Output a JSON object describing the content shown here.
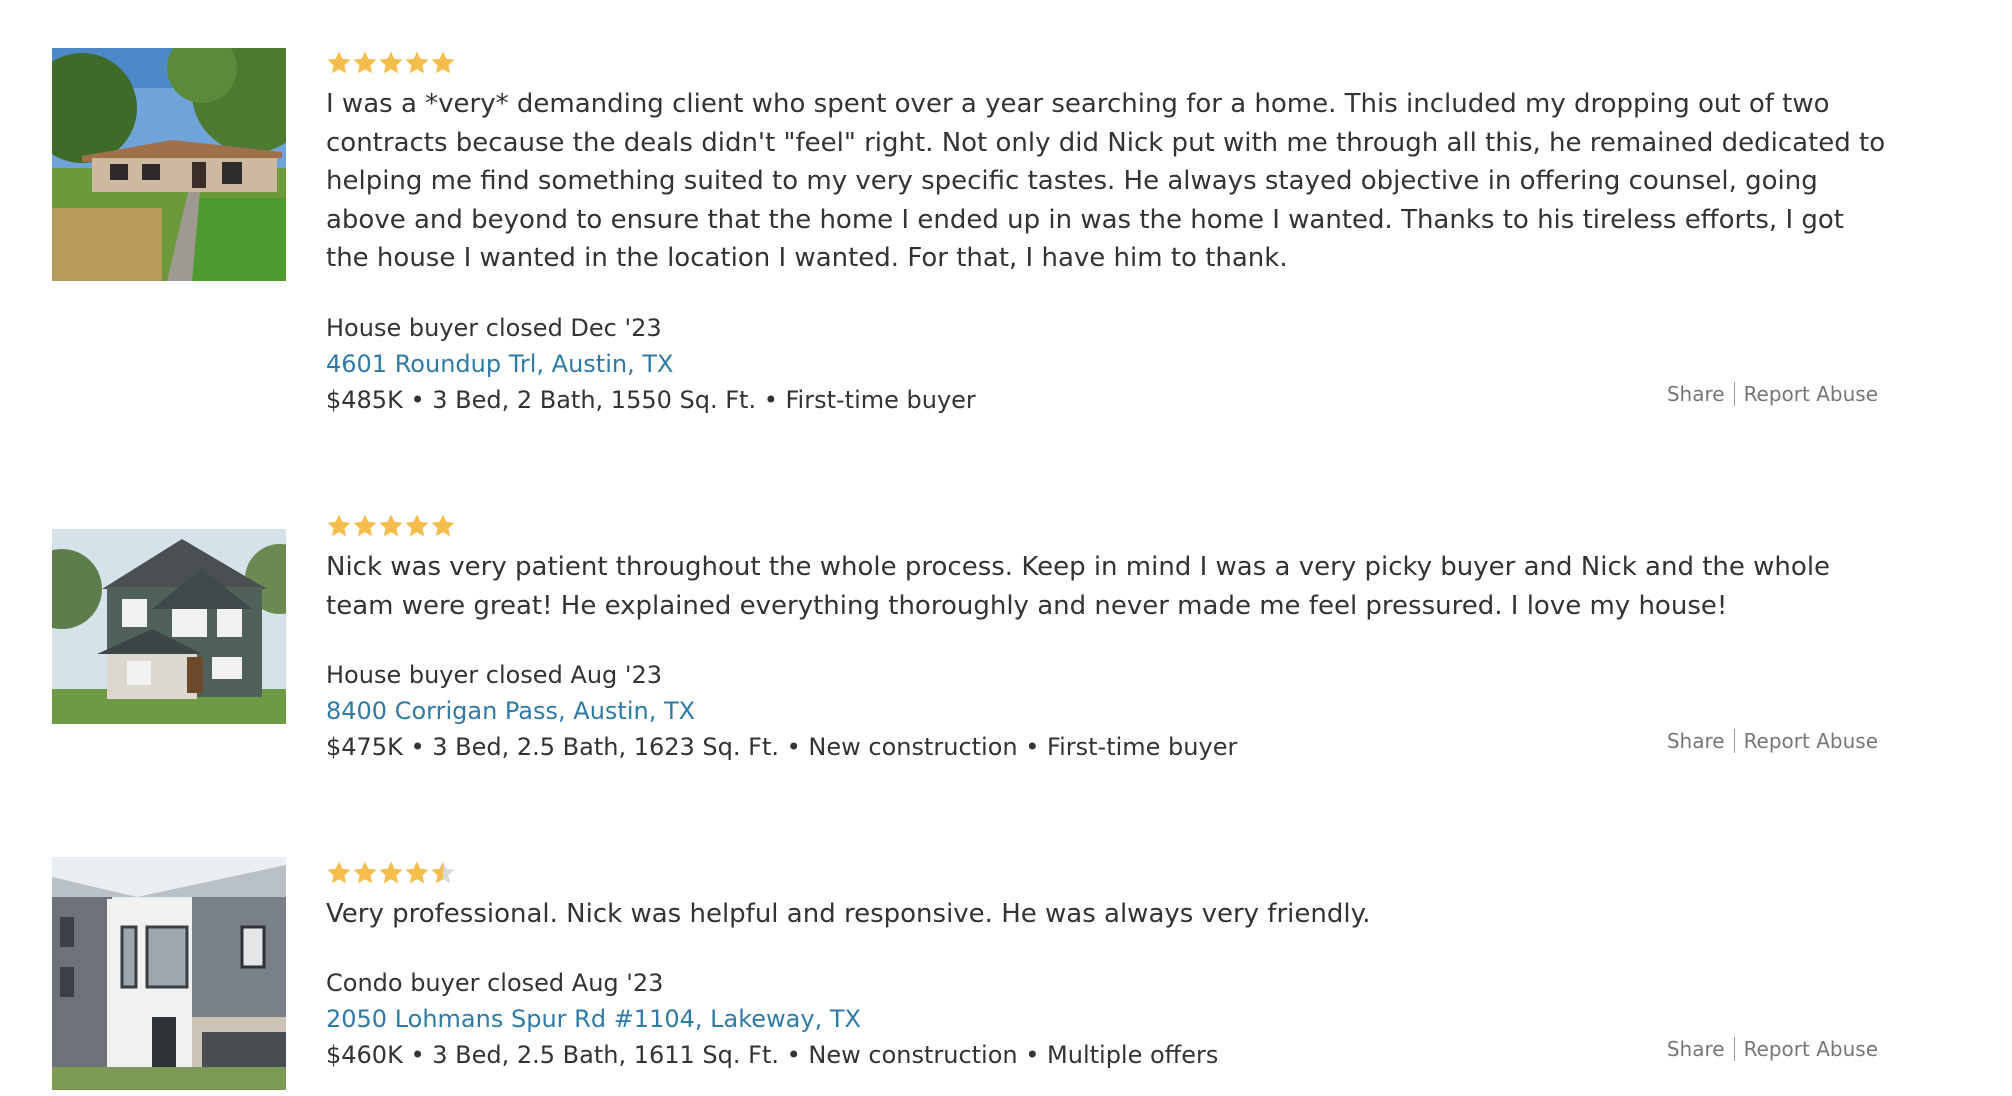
{
  "colors": {
    "star_fill": "#f5bd4b",
    "star_empty": "#d9d9d9",
    "link": "#2f7ba6",
    "text": "#333333",
    "muted": "#767676"
  },
  "reviews": [
    {
      "rating": 5,
      "photo_icon": "house-photo-single-story",
      "text": "I was a *very* demanding client who spent over a year searching for a home. This included my dropping out of two contracts because the deals didn't \"feel\" right. Not only did Nick put with me through all this, he remained dedicated to helping me find something suited to my very specific tastes. He always stayed objective in offering counsel, going above and beyond to ensure that the home I ended up in was the home I wanted. Thanks to his tireless efforts, I got the house I wanted in the location I wanted. For that, I have him to thank.",
      "closed": "House buyer closed Dec '23",
      "address": "4601 Roundup Trl, Austin, TX",
      "details": "$485K • 3 Bed, 2 Bath, 1550 Sq. Ft. • First-time buyer",
      "share_label": "Share",
      "report_label": "Report Abuse"
    },
    {
      "rating": 5,
      "photo_icon": "house-photo-two-story",
      "text": "Nick was very patient throughout the whole process. Keep in mind I was a very picky buyer and Nick and the whole team were great! He explained everything thoroughly and never made me feel pressured. I love my house!",
      "closed": "House buyer closed Aug '23",
      "address": "8400 Corrigan Pass, Austin, TX",
      "details": "$475K • 3 Bed, 2.5 Bath, 1623 Sq. Ft. • New construction • First-time buyer",
      "share_label": "Share",
      "report_label": "Report Abuse"
    },
    {
      "rating": 4.5,
      "photo_icon": "condo-photo-modern",
      "text": "Very professional. Nick was helpful and responsive. He was always very friendly.",
      "closed": "Condo buyer closed Aug '23",
      "address": "2050 Lohmans Spur Rd #1104, Lakeway, TX",
      "details": "$460K • 3 Bed, 2.5 Bath, 1611 Sq. Ft. • New construction • Multiple offers",
      "share_label": "Share",
      "report_label": "Report Abuse"
    }
  ]
}
